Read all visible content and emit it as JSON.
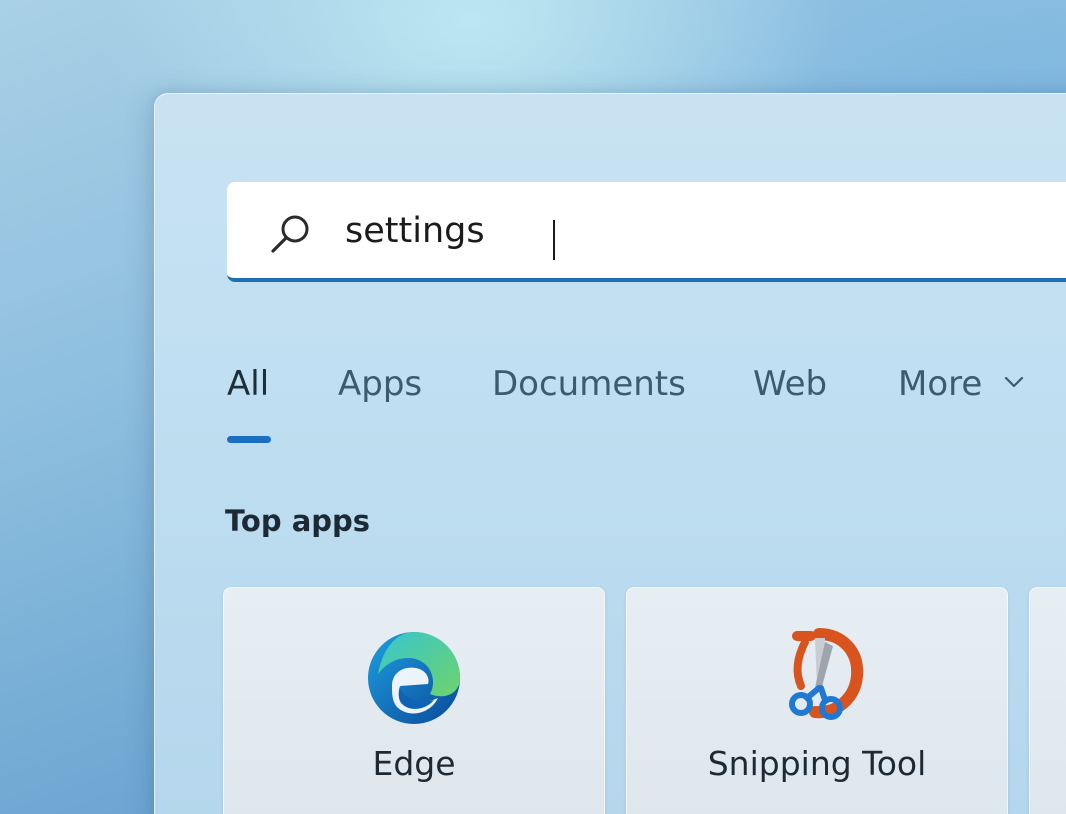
{
  "search": {
    "value": "settings",
    "icon": "search-icon"
  },
  "tabs": [
    {
      "label": "All",
      "active": true
    },
    {
      "label": "Apps",
      "active": false
    },
    {
      "label": "Documents",
      "active": false
    },
    {
      "label": "Web",
      "active": false
    },
    {
      "label": "More",
      "active": false,
      "icon": "chevron-down-icon"
    }
  ],
  "top_apps": {
    "title": "Top apps",
    "items": [
      {
        "label": "Edge",
        "icon": "edge-icon"
      },
      {
        "label": "Snipping Tool",
        "icon": "snipping-tool-icon"
      }
    ]
  },
  "colors": {
    "accent": "#1a6fc0",
    "search_underline": "#1f6fb2",
    "panel": "#c2e0f2"
  }
}
